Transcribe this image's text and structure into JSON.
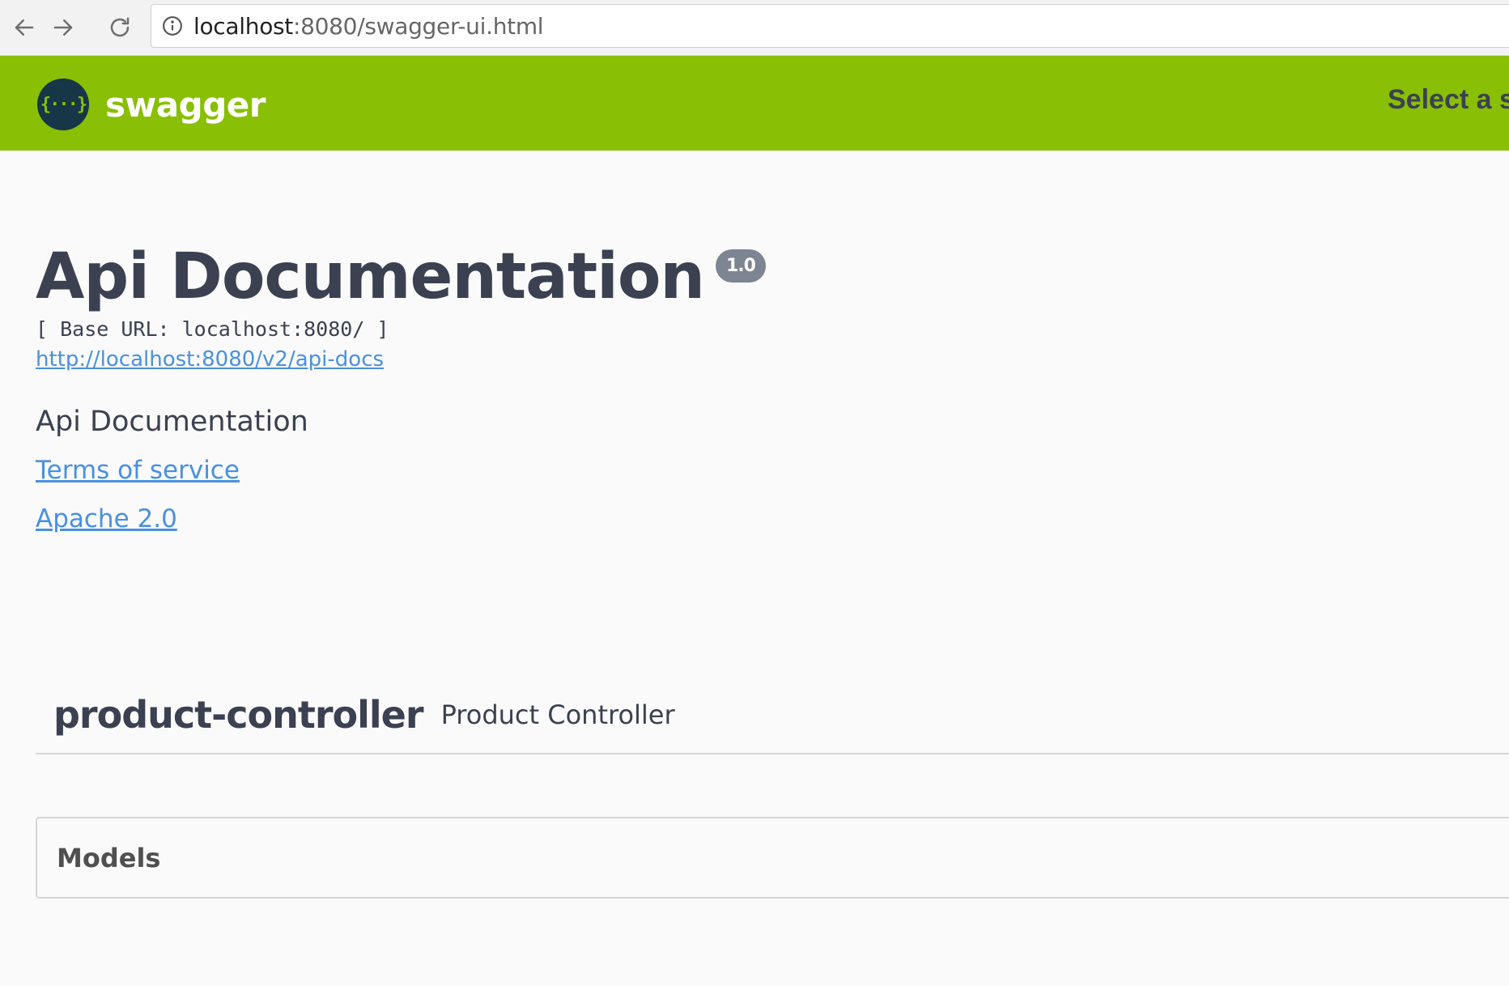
{
  "browser": {
    "url_host": "localhost",
    "url_rest": ":8080/swagger-ui.html"
  },
  "topbar": {
    "logo_text": "swagger",
    "logo_glyph": "{···}",
    "select_spec_label": "Select a spec",
    "bg_color": "#89bf04"
  },
  "info": {
    "title": "Api Documentation",
    "version": "1.0",
    "base_url": "[ Base URL: localhost:8080/ ]",
    "api_docs_link": "http://localhost:8080/v2/api-docs",
    "description": "Api Documentation",
    "terms_link": "Terms of service",
    "license_link": "Apache 2.0"
  },
  "tags": [
    {
      "name": "product-controller",
      "description": "Product Controller"
    }
  ],
  "models": {
    "title": "Models"
  },
  "icons": {
    "back": "back-arrow-icon",
    "forward": "forward-arrow-icon",
    "reload": "reload-icon",
    "info": "info-icon",
    "logo": "swagger-logo-icon"
  },
  "colors": {
    "link": "#4990e2",
    "text": "#3b4151",
    "version_badge": "#7d8492"
  }
}
